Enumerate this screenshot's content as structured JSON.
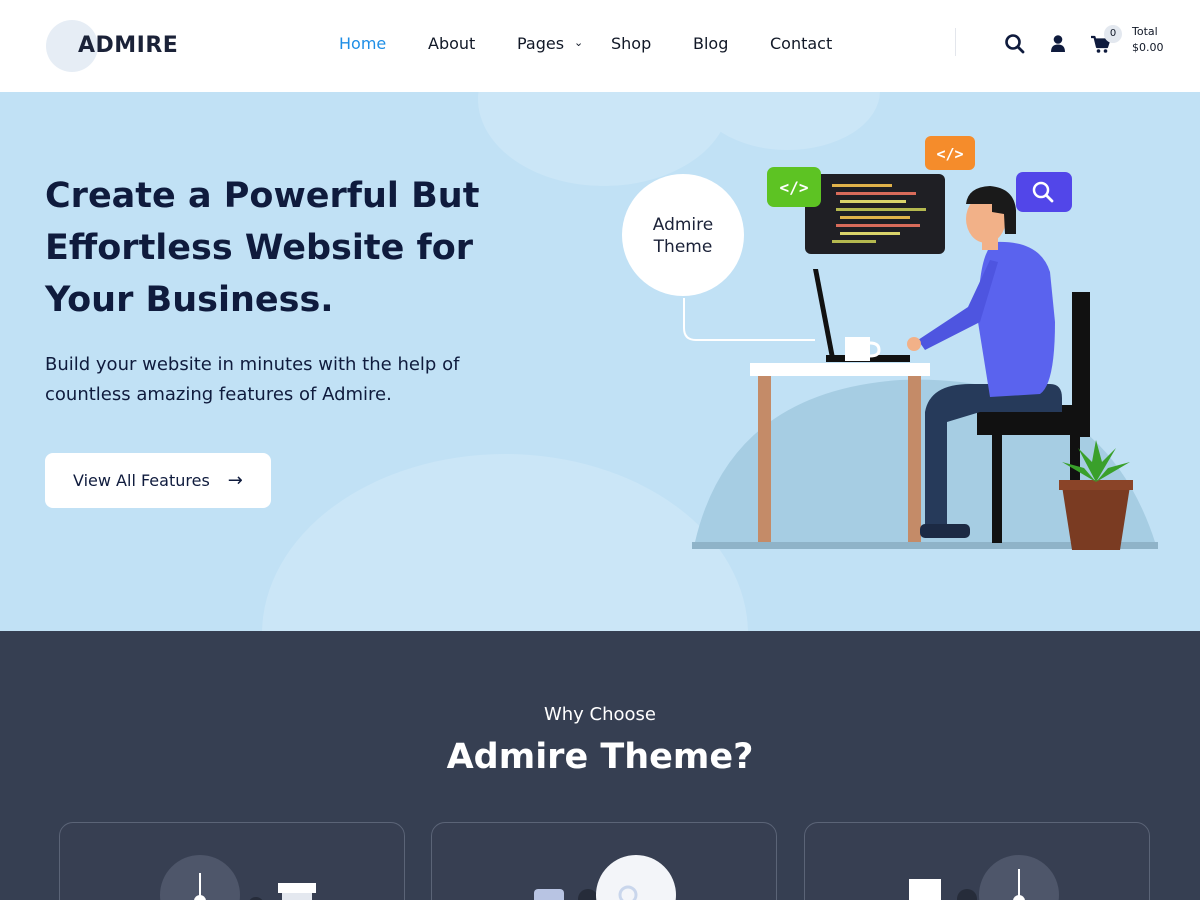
{
  "brand": {
    "name": "ADMIRE"
  },
  "nav": {
    "items": [
      {
        "label": "Home",
        "active": true
      },
      {
        "label": "About"
      },
      {
        "label": "Pages",
        "has_dropdown": true
      },
      {
        "label": "Shop"
      },
      {
        "label": "Blog"
      },
      {
        "label": "Contact"
      }
    ]
  },
  "header_icons": [
    "search-icon",
    "user-icon",
    "cart-icon"
  ],
  "cart": {
    "count": "0",
    "total_label": "Total",
    "total_value": "$0.00"
  },
  "hero": {
    "title": "Create a Powerful But Effortless Website for Your Business.",
    "subtitle": "Build your website in minutes with the help of countless amazing features of Admire.",
    "button_label": "View All Features",
    "illustration_bubble": [
      "Admire",
      "Theme"
    ],
    "code_icon_symbol": "</>"
  },
  "why": {
    "kicker": "Why Choose",
    "title": "Admire Theme?"
  },
  "colors": {
    "accent": "#1e8ee6",
    "hero_bg": "#c1e1f5",
    "dark_section": "#363f52",
    "heading": "#0f1b3d"
  }
}
